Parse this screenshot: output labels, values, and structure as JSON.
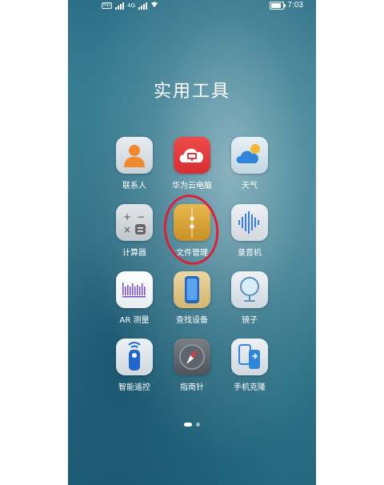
{
  "status_bar": {
    "left_badges": [
      "HD",
      "HD"
    ],
    "network": "4G",
    "time": "7:03"
  },
  "folder": {
    "title": "实用工具"
  },
  "apps": [
    {
      "label": "联系人",
      "icon": "contacts-icon"
    },
    {
      "label": "华为云电脑",
      "icon": "cloud-pc-icon"
    },
    {
      "label": "天气",
      "icon": "weather-icon"
    },
    {
      "label": "计算器",
      "icon": "calculator-icon"
    },
    {
      "label": "文件管理",
      "icon": "file-manager-icon"
    },
    {
      "label": "录音机",
      "icon": "recorder-icon"
    },
    {
      "label": "AR 测量",
      "icon": "ar-measure-icon"
    },
    {
      "label": "查找设备",
      "icon": "find-device-icon"
    },
    {
      "label": "镜子",
      "icon": "mirror-icon"
    },
    {
      "label": "智能遥控",
      "icon": "remote-control-icon"
    },
    {
      "label": "指南针",
      "icon": "compass-icon"
    },
    {
      "label": "手机克隆",
      "icon": "phone-clone-icon"
    }
  ],
  "pagination": {
    "pages": 2,
    "current": 1
  },
  "colors": {
    "annotation_circle": "#d9223a",
    "cloud_pc_red": "#e23a3a",
    "file_manager_gold": "#d9a43a"
  }
}
